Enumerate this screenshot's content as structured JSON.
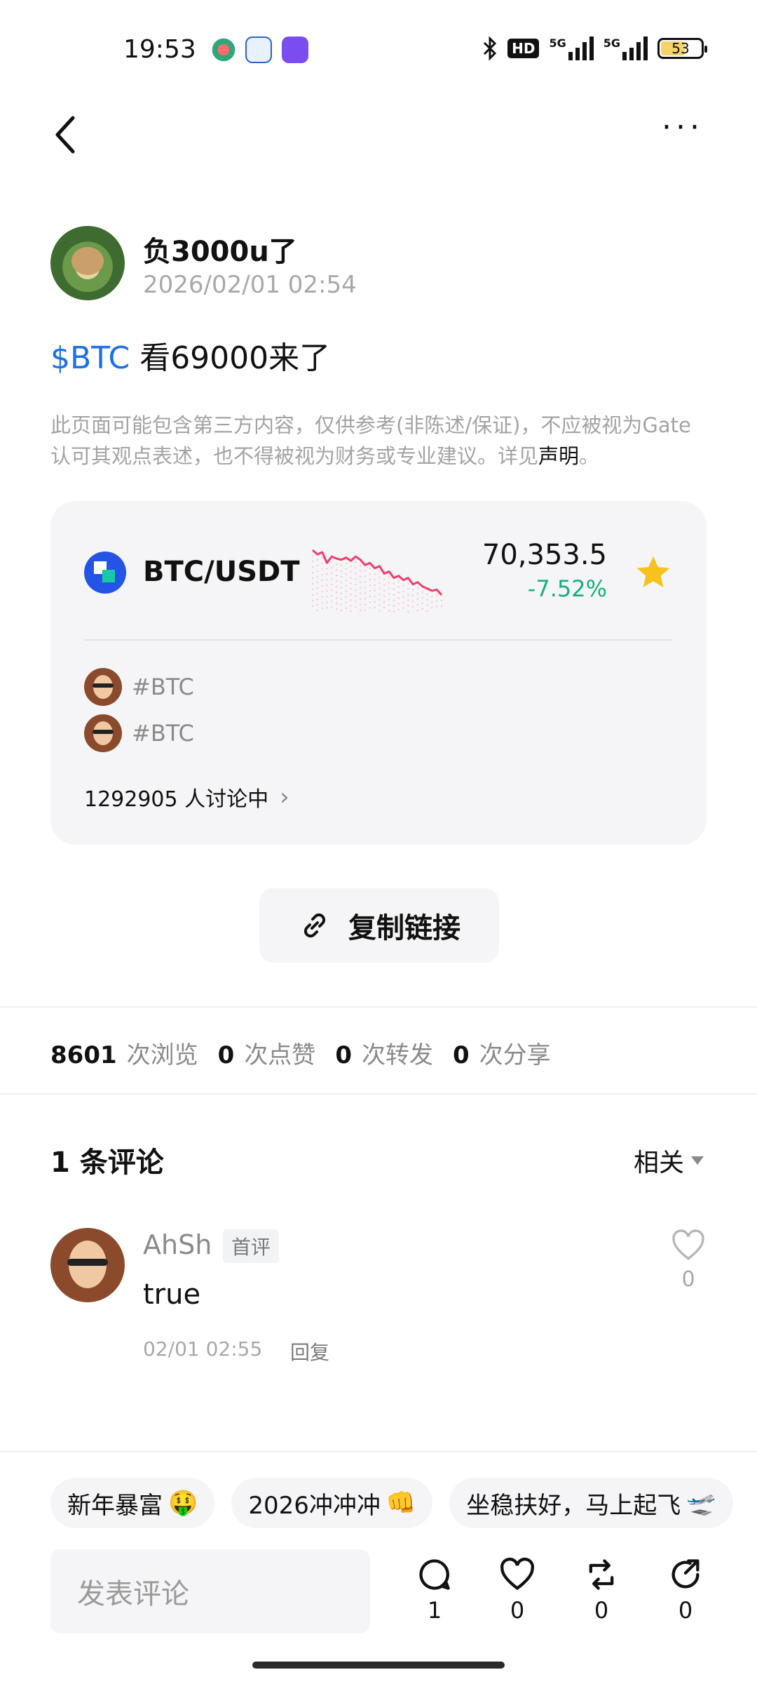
{
  "status_bar": {
    "time": "19:53",
    "network": "5G",
    "battery": "53",
    "hd_badge": "HD",
    "icons": [
      "bluetooth-icon",
      "hd-voice-icon",
      "signal-5g-icon",
      "signal-5g-icon",
      "battery-icon"
    ]
  },
  "nav": {
    "back_icon": "chevron-left-icon",
    "more_label": "···"
  },
  "post": {
    "author_name": "负3000u了",
    "timestamp": "2026/02/01 02:54",
    "ticker": "$BTC",
    "text": " 看69000来了",
    "disclaimer": "此页面可能包含第三方内容，仅供参考(非陈述/保证)，不应被视为Gate认可其观点表述，也不得被视为财务或专业建议。详见",
    "disclaimer_link": "声明",
    "disclaimer_end": "。"
  },
  "market_card": {
    "pair": "BTC/USDT",
    "price": "70,353.5",
    "change": "-7.52%",
    "change_color": "#16b07b",
    "spark_color": "#ef3e6b",
    "sparkline": [
      72,
      68,
      70,
      60,
      66,
      64,
      63,
      65,
      62,
      66,
      63,
      58,
      60,
      55,
      57,
      50,
      52,
      46,
      48,
      44,
      46,
      40,
      42,
      38,
      36,
      34,
      35,
      30
    ],
    "tags": [
      "#BTC",
      "#BTC"
    ],
    "discussion": "1292905 人讨论中"
  },
  "copy_link": {
    "label": "复制链接",
    "icon": "link-icon"
  },
  "stats": {
    "views": "8601",
    "views_label": "次浏览",
    "likes": "0",
    "likes_label": "次点赞",
    "reposts": "0",
    "reposts_label": "次转发",
    "shares": "0",
    "shares_label": "次分享"
  },
  "comments": {
    "title": "1 条评论",
    "sort_label": "相关",
    "items": [
      {
        "name": "AhSh",
        "badge": "首评",
        "text": "true",
        "date": "02/01 02:55",
        "reply": "回复",
        "likes": "0"
      }
    ]
  },
  "quick_replies": [
    {
      "label": "新年暴富",
      "emoji": "🤑"
    },
    {
      "label": "2026冲冲冲",
      "emoji": "👊"
    },
    {
      "label": "坐稳扶好，马上起飞",
      "emoji": "🛫"
    }
  ],
  "bottom_bar": {
    "input_placeholder": "发表评论",
    "comment_count": "1",
    "like_count": "0",
    "repost_count": "0",
    "share_count": "0"
  }
}
